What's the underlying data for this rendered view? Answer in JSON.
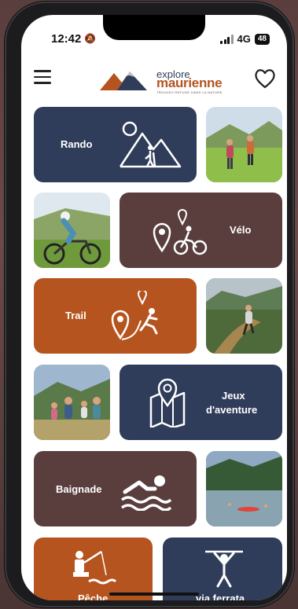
{
  "status_bar": {
    "time": "12:42",
    "network": "4G",
    "battery": "48"
  },
  "header": {
    "logo_line1": "explore",
    "logo_line2": "maurienne",
    "logo_tagline": "TROUVEZ REFUGE DANS LA NATURE"
  },
  "colors": {
    "navy": "#2f3d5a",
    "brown": "#5a3e3e",
    "rust": "#b5541f"
  },
  "activities": [
    {
      "label": "Rando",
      "icon": "hiking-icon"
    },
    {
      "label": "Vélo",
      "icon": "cycling-icon"
    },
    {
      "label": "Trail",
      "icon": "trail-running-icon"
    },
    {
      "label": "Jeux d'aventure",
      "label_line1": "Jeux",
      "label_line2": "d'aventure",
      "icon": "map-pin-icon"
    },
    {
      "label": "Baignade",
      "icon": "swimming-icon"
    },
    {
      "label": "Pêche",
      "icon": "fishing-icon"
    },
    {
      "label": "via ferrata",
      "icon": "via-ferrata-icon"
    }
  ]
}
